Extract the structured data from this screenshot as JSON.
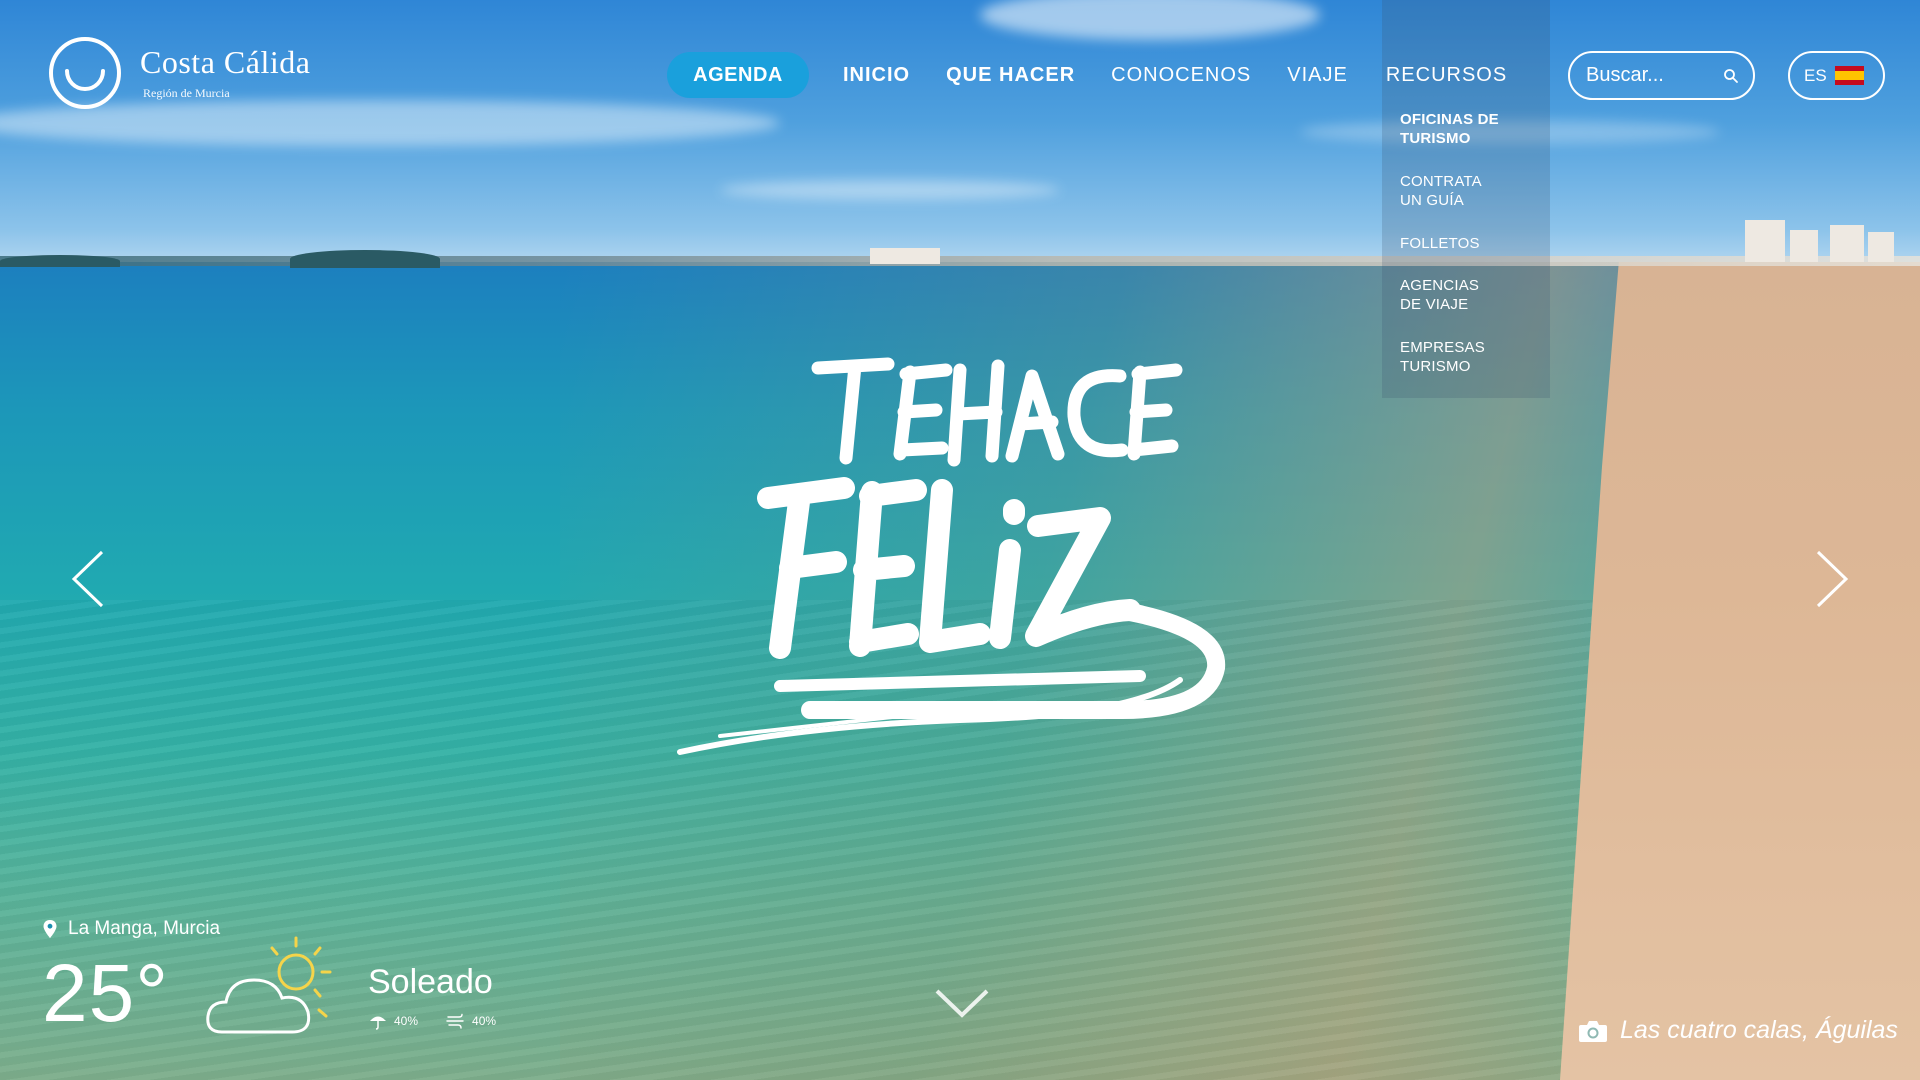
{
  "brand": {
    "name": "Costa Cálida",
    "subtitle": "Región de Murcia"
  },
  "nav": {
    "agenda": "AGENDA",
    "items": [
      "INICIO",
      "QUE HACER",
      "CONOCENOS",
      "VIAJE",
      "RECURSOS"
    ]
  },
  "search": {
    "placeholder": "Buscar..."
  },
  "language": {
    "code": "ES",
    "flag": "spain-flag-icon"
  },
  "dropdown": {
    "parent": "RECURSOS",
    "items": [
      {
        "line1": "OFICINAS DE",
        "line2": "TURISMO"
      },
      {
        "line1": "CONTRATA",
        "line2": "UN GUÍA"
      },
      {
        "line1": "FOLLETOS",
        "line2": ""
      },
      {
        "line1": "AGENCIAS",
        "line2": "DE VIAJE"
      },
      {
        "line1": "EMPRESAS",
        "line2": "TURISMO"
      }
    ]
  },
  "hero": {
    "line1": "TE HACE",
    "line2": "FELIZ"
  },
  "weather": {
    "location": "La Manga, Murcia",
    "temperature": "25°",
    "condition": "Soleado",
    "rain": "40%",
    "wind": "40%",
    "icon": "partly-sunny-icon"
  },
  "caption": {
    "text": "Las cuatro calas, Águilas",
    "icon": "camera-icon"
  },
  "colors": {
    "accent": "#1aa0dc",
    "sea": "#20a9b1",
    "sand": "#ddb796"
  }
}
